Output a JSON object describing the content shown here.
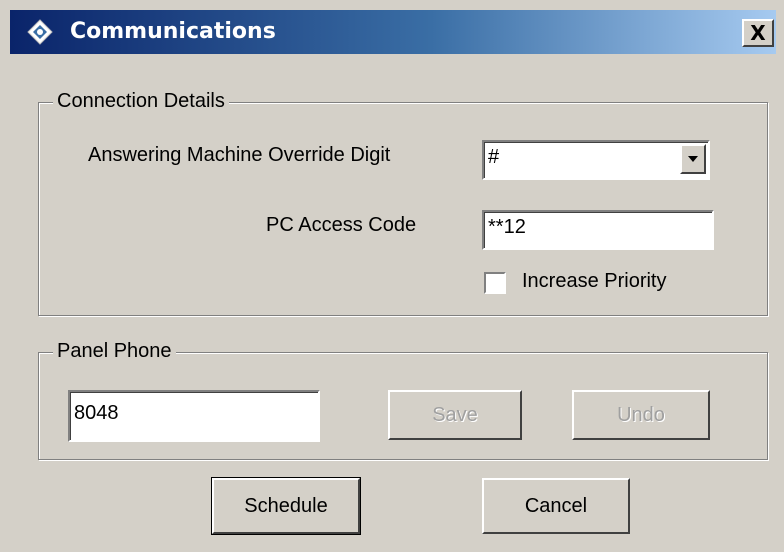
{
  "window": {
    "title": "Communications",
    "close_label": "X"
  },
  "connection_details": {
    "legend": "Connection Details",
    "override_digit": {
      "label": "Answering Machine Override Digit",
      "value": "#"
    },
    "pc_access_code": {
      "label": "PC Access Code",
      "value": "**12"
    },
    "increase_priority": {
      "label": "Increase Priority",
      "checked": false
    }
  },
  "panel_phone": {
    "legend": "Panel Phone",
    "value": "8048",
    "save_label": "Save",
    "undo_label": "Undo"
  },
  "footer": {
    "schedule_label": "Schedule",
    "cancel_label": "Cancel"
  }
}
